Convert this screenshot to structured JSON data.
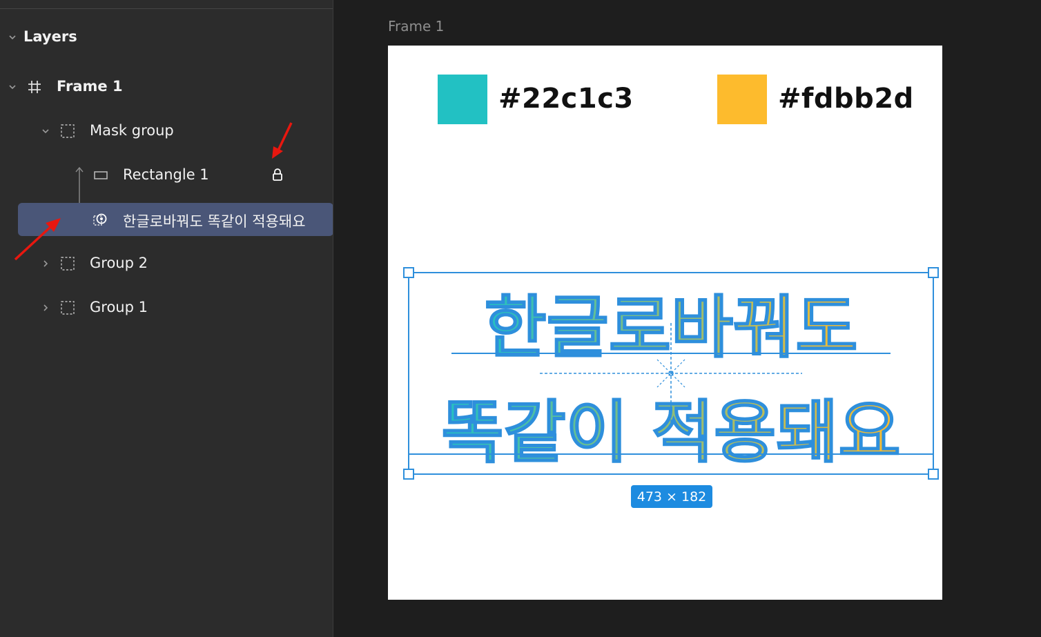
{
  "layers_panel": {
    "title": "Layers",
    "items": [
      {
        "label": "Frame 1",
        "icon": "frame-hash-icon"
      },
      {
        "label": "Mask group",
        "icon": "group-dashed-icon"
      },
      {
        "label": "Rectangle 1",
        "icon": "rectangle-icon",
        "locked": true
      },
      {
        "label": "한글로바꿔도 똑같이 적용돼요",
        "icon": "text-mask-icon",
        "selected": true
      },
      {
        "label": "Group 2",
        "icon": "group-dashed-icon"
      },
      {
        "label": "Group 1",
        "icon": "group-dashed-icon"
      }
    ]
  },
  "canvas": {
    "frame_label": "Frame 1",
    "swatches": [
      {
        "color": "#22c1c3",
        "hex_label": "#22c1c3"
      },
      {
        "color": "#fdbb2d",
        "hex_label": "#fdbb2d"
      }
    ],
    "text_lines": [
      "한글로바꿔도",
      "똑같이 적용돼요"
    ],
    "selection_size": "473 × 182",
    "selection_color": "#1d8be0",
    "gradient_start": "#22c1c3",
    "gradient_end": "#fdbb2d"
  }
}
